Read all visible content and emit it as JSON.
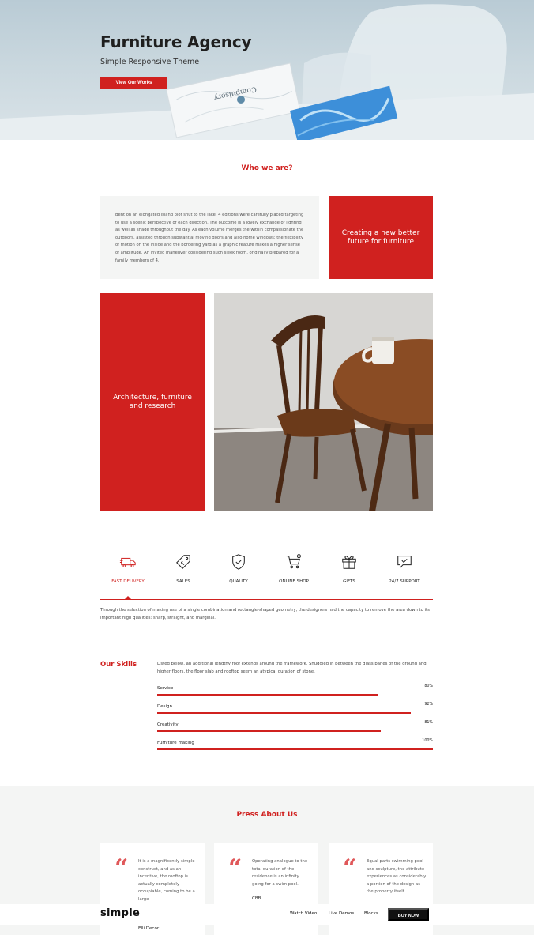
{
  "hero": {
    "title": "Furniture Agency",
    "subtitle": "Simple Responsive Theme",
    "button_label": "View Our Works",
    "book_text": "Compulsory"
  },
  "about": {
    "section_title": "Who we are?",
    "paragraph": "Bent on an elongated island plot shut to the lake, 4 editions were carefully placed targeting to use a scenic perspective of each direction. The outcome is a lovely exchange of lighting as well as shade throughout the day. As each volume merges the within compassionate the outdoors, assisted through substantial moving doors and also home windows; the flexibility of motion on the inside and the bordering yard as a graphic feature makes a higher sense of amplitude. An invited maneuver considering such sleek room, originally prepared for a family members of 4.",
    "red_box_1": "Creating a new better future for furniture",
    "red_box_2": "Architecture, furniture and research"
  },
  "features": {
    "items": [
      {
        "label": "Fast Delivery",
        "icon": "truck-icon"
      },
      {
        "label": "Sales",
        "icon": "tag-icon"
      },
      {
        "label": "Quality",
        "icon": "shield-icon"
      },
      {
        "label": "Online Shop",
        "icon": "cart-icon"
      },
      {
        "label": "Gifts",
        "icon": "gift-icon"
      },
      {
        "label": "24/7 Support",
        "icon": "chat-icon"
      }
    ],
    "active_index": 0,
    "description": "Through the selection of making use of a single combination and rectangle-shaped geometry, the designers had the capacity to remove the area down to its important high qualities: sharp, straight, and marginal."
  },
  "skills": {
    "title": "Our Skills",
    "intro": "Listed below, an additional lengthy roof extends around the framework. Snuggled in between the glass panes of the ground and higher floors, the floor slab and rooftop seem an atypical duration of stone.",
    "items": [
      {
        "name": "Service",
        "percent": "80%",
        "value": 80
      },
      {
        "name": "Design",
        "percent": "92%",
        "value": 92
      },
      {
        "name": "Creativity",
        "percent": "81%",
        "value": 81
      },
      {
        "name": "Furniture making",
        "percent": "100%",
        "value": 100
      }
    ]
  },
  "press": {
    "title": "Press About Us",
    "cards": [
      {
        "text": "It is a magnificently simple construct, and as an incentive, the rooftop is actually completely occupiable, coming to be a large",
        "author": "Elli Decor"
      },
      {
        "text": "Operating analogue to the total duration of the residence is an infinity going for a swim pool.",
        "author": "CBB"
      },
      {
        "text": "Equal parts swimming pool and sculpture, the attribute experiences as considerably a portion of the design as the property itself.",
        "author": ""
      }
    ]
  },
  "nav": {
    "logo": "simple",
    "links": [
      "Watch Video",
      "Live Demos",
      "Blocks"
    ],
    "buy_label": "BUY NOW"
  },
  "colors": {
    "accent": "#d0211f",
    "panel": "#f4f5f4",
    "dark": "#111111"
  }
}
